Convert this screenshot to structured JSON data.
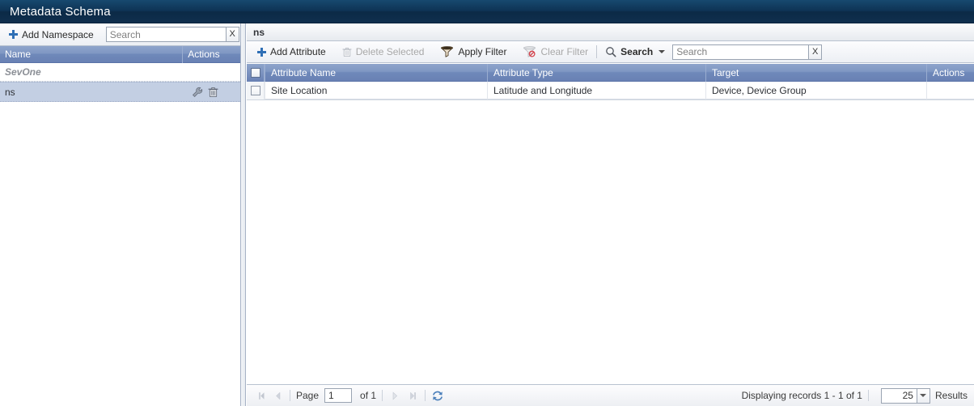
{
  "titlebar": {
    "title": "Metadata Schema"
  },
  "left_panel": {
    "toolbar": {
      "add_namespace_label": "Add Namespace",
      "add_icon": "plus-icon",
      "search_placeholder": "Search",
      "search_value": "",
      "clear_label": "X"
    },
    "columns": [
      {
        "label": "Name"
      },
      {
        "label": "Actions"
      }
    ],
    "group_label": "SevOne",
    "rows": [
      {
        "name": "ns",
        "selected": true,
        "actions": [
          "wrench-icon",
          "trash-icon"
        ]
      }
    ]
  },
  "right_panel": {
    "tab_title": "ns",
    "toolbar": {
      "add_attribute_label": "Add Attribute",
      "add_icon": "plus-icon",
      "delete_selected_label": "Delete Selected",
      "delete_icon": "trash-icon",
      "delete_enabled": false,
      "apply_filter_label": "Apply Filter",
      "apply_filter_icon": "funnel-icon",
      "apply_filter_enabled": true,
      "clear_filter_label": "Clear Filter",
      "clear_filter_icon": "funnel-blocked-icon",
      "clear_filter_enabled": false,
      "search_button_label": "Search",
      "search_button_icon": "magnifier-icon",
      "search_placeholder": "Search",
      "search_value": "",
      "search_clear_label": "X"
    },
    "grid": {
      "columns": [
        {
          "label": "Attribute Name"
        },
        {
          "label": "Attribute Type"
        },
        {
          "label": "Target"
        },
        {
          "label": "Actions"
        }
      ],
      "rows": [
        {
          "checked": false,
          "attribute_name": "Site Location",
          "attribute_type": "Latitude and Longitude",
          "target": "Device, Device Group",
          "actions": ""
        }
      ]
    },
    "footer": {
      "first_icon": "first-page-icon",
      "prev_icon": "prev-page-icon",
      "page_label": "Page",
      "page_value": "1",
      "of_label": "of 1",
      "next_icon": "next-page-icon",
      "last_icon": "last-page-icon",
      "refresh_icon": "refresh-icon",
      "displaying_text": "Displaying records 1 - 1 of 1",
      "page_size_value": "25",
      "results_label": "Results"
    }
  },
  "colors": {
    "titlebar_dark": "#0e3354",
    "grid_header_blue": "#6f89ba",
    "accent_blue": "#2f6fb5",
    "selected_row": "#c3cfe3",
    "disabled_text": "#a8a8a8"
  }
}
